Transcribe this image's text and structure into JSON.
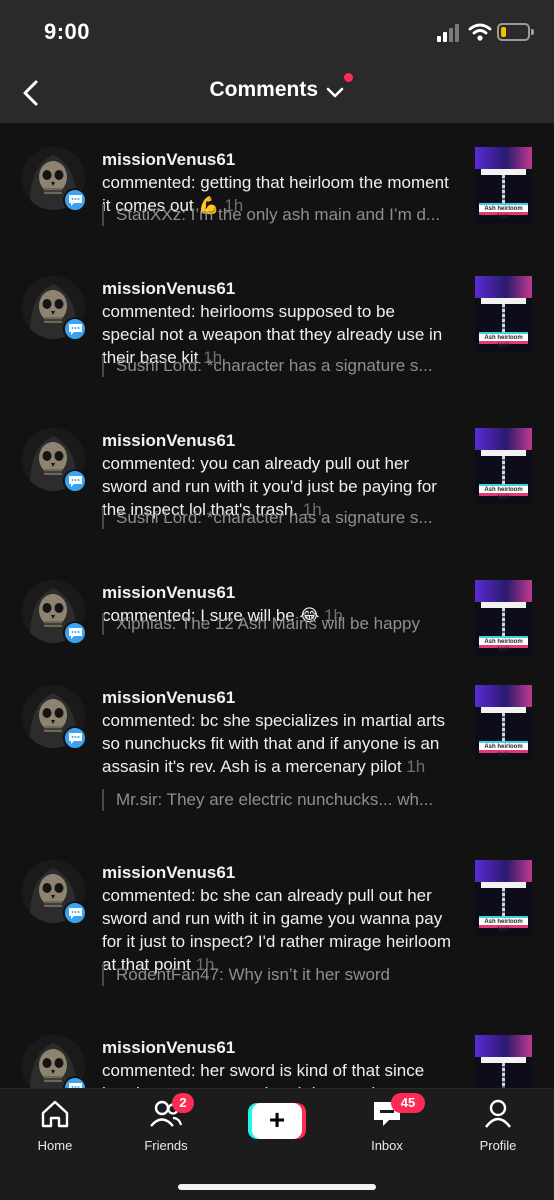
{
  "status_bar": {
    "time": "9:00"
  },
  "header": {
    "title": "Comments"
  },
  "comments": [
    {
      "user": "missionVenus61",
      "text": "commented: getting that heirloom the moment it comes out",
      "emoji": "💪",
      "ago": "1h",
      "quote": "StatiXXz: I’m the only ash main and I’m d..."
    },
    {
      "user": "missionVenus61",
      "text": "commented: heirlooms supposed to be special not a weapon that they already use in their base kit",
      "emoji": "",
      "ago": "1h",
      "quote": "Sushi Lord: *character has a signature s..."
    },
    {
      "user": "missionVenus61",
      "text": "commented: you can already pull out her sword and run with it you'd just be paying for the inspect lol that's trash.",
      "emoji": "",
      "ago": "1h",
      "quote": "Sushi Lord: *character has a signature s..."
    },
    {
      "user": "missionVenus61",
      "text": "commented: I sure will be",
      "emoji": "😂",
      "ago": "1h",
      "quote": "Xiphias: The 12 Ash Mains will be happy"
    },
    {
      "user": "missionVenus61",
      "text": "commented: bc she specializes in martial arts so nunchucks fit with that and if anyone is an assasin it's rev. Ash is a mercenary pilot",
      "emoji": "",
      "ago": "1h",
      "quote": "Mr.sir: They are electric nunchucks... wh..."
    },
    {
      "user": "missionVenus61",
      "text": "commented: bc she can already pull out her sword and run with it in game you wanna pay for it just to inspect? I'd rather mirage heirloom at that point",
      "emoji": "",
      "ago": "1h",
      "quote": "RodentFan47: Why isn’t it her sword"
    },
    {
      "user": "missionVenus61",
      "text": "commented: her sword is kind of that since her titan uses a sword and does a phase",
      "emoji": "",
      "ago": "",
      "quote": ""
    }
  ],
  "thumbnail": {
    "caption": "Ash heirloom leak"
  },
  "nav": {
    "home": "Home",
    "friends": "Friends",
    "friends_count": "2",
    "inbox": "Inbox",
    "inbox_count": "45",
    "profile": "Profile",
    "create": "+"
  },
  "colors": {
    "accent": "#fe2c55",
    "cyan": "#25f4ee",
    "badge": "#3aa4f0"
  }
}
